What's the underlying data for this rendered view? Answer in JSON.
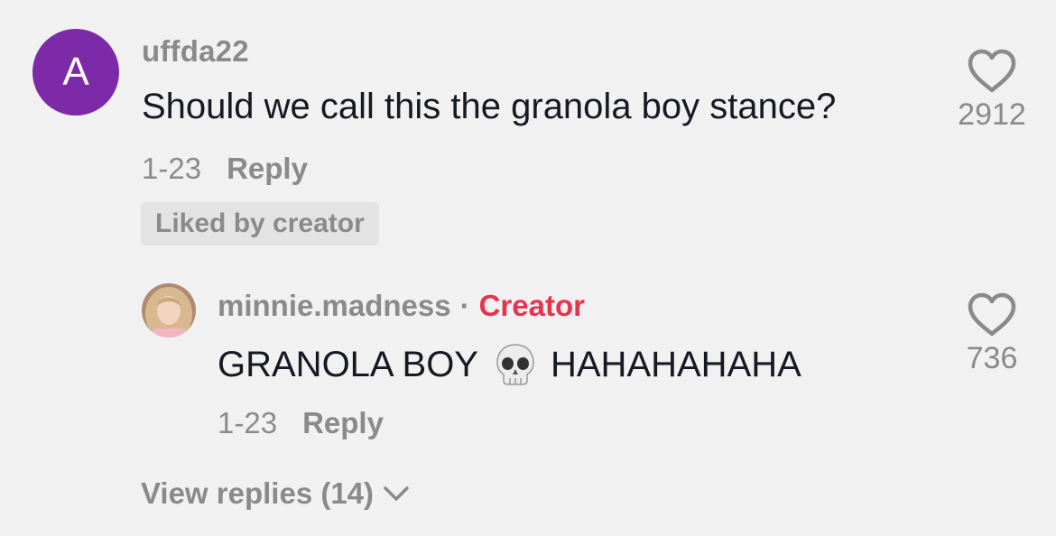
{
  "comment": {
    "avatar_letter": "A",
    "avatar_color": "#7d2aa8",
    "username": "uffda22",
    "text": "Should we call this the granola boy stance?",
    "date": "1-23",
    "reply_label": "Reply",
    "badge": "Liked by creator",
    "like_count": "2912",
    "like_icon": "heart-outline-icon"
  },
  "reply": {
    "username": "minnie.madness",
    "separator": "·",
    "creator_label": "Creator",
    "creator_color": "#e6344f",
    "text_before": "GRANOLA BOY",
    "emoji_icon": "skull-icon",
    "text_after": "HAHAHAHAHA",
    "date": "1-23",
    "reply_label": "Reply",
    "like_count": "736",
    "like_icon": "heart-outline-icon"
  },
  "view_replies": {
    "label": "View replies (14)",
    "icon": "chevron-down-icon"
  }
}
